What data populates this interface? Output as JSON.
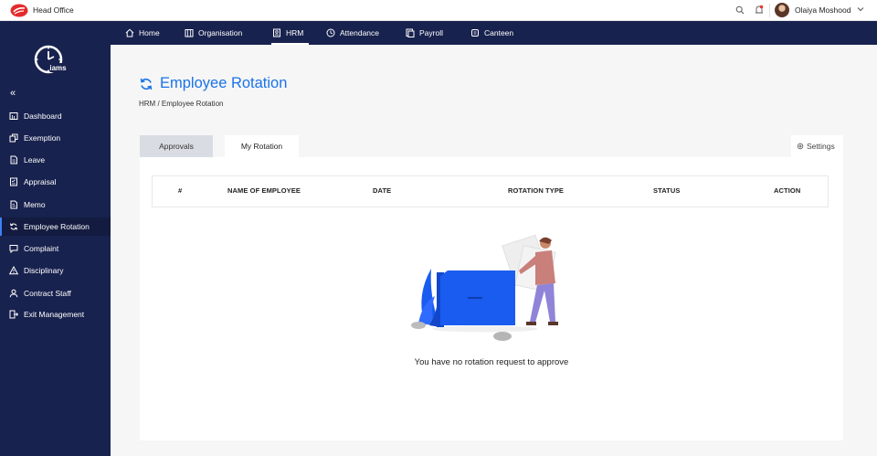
{
  "topbar": {
    "office": "Head Office",
    "user_name": "Olaiya Moshood",
    "icons": [
      "logo-icon",
      "search-icon",
      "bell-icon",
      "avatar",
      "chevron-down-icon"
    ]
  },
  "nav": {
    "items": [
      {
        "label": "Home",
        "icon": "home-icon"
      },
      {
        "label": "Organisation",
        "icon": "building-icon"
      },
      {
        "label": "HRM",
        "icon": "id-card-icon",
        "active": true
      },
      {
        "label": "Attendance",
        "icon": "clock-icon"
      },
      {
        "label": "Payroll",
        "icon": "payroll-icon"
      },
      {
        "label": "Canteen",
        "icon": "canteen-icon"
      }
    ]
  },
  "sidebar": {
    "logo_text": "iams",
    "collapse": "«",
    "items": [
      {
        "label": "Dashboard",
        "icon": "dashboard-icon"
      },
      {
        "label": "Exemption",
        "icon": "copy-icon"
      },
      {
        "label": "Leave",
        "icon": "document-icon"
      },
      {
        "label": "Appraisal",
        "icon": "checklist-icon"
      },
      {
        "label": "Memo",
        "icon": "memo-icon"
      },
      {
        "label": "Employee Rotation",
        "icon": "rotation-icon",
        "active": true
      },
      {
        "label": "Complaint",
        "icon": "chat-icon"
      },
      {
        "label": "Disciplinary",
        "icon": "warning-icon"
      },
      {
        "label": "Contract Staff",
        "icon": "user-icon"
      },
      {
        "label": "Exit Management",
        "icon": "exit-icon"
      }
    ]
  },
  "page": {
    "title": "Employee Rotation",
    "breadcrumb": "HRM / Employee Rotation"
  },
  "tabs": {
    "approvals": "Approvals",
    "my_rotation": "My Rotation",
    "settings": "Settings"
  },
  "table": {
    "columns": [
      "#",
      "NAME OF EMPLOYEE",
      "DATE",
      "ROTATION TYPE",
      "STATUS",
      "ACTION"
    ]
  },
  "empty_state": {
    "message": "You have no rotation request to approve"
  },
  "colors": {
    "navy": "#18224e",
    "accent": "#1a73e8",
    "folder_blue": "#1a5cf0"
  }
}
